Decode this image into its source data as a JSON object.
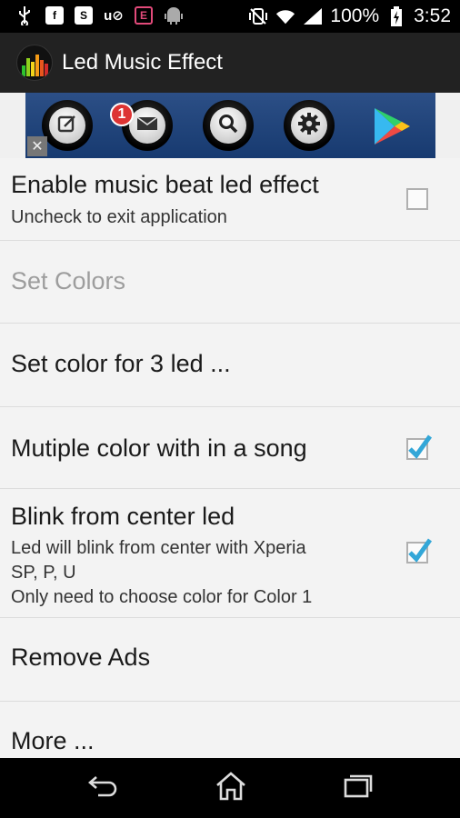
{
  "status_bar": {
    "battery_percent": "100%",
    "time": "3:52",
    "left_icons": [
      "usb-icon",
      "facebook-icon",
      "skype-icon",
      "unknown-app-icon",
      "e-app-icon",
      "android-icon"
    ],
    "right_icons": [
      "vibrate-off-icon",
      "wifi-icon",
      "signal-icon",
      "battery-charging-icon"
    ]
  },
  "app_bar": {
    "title": "Led Music Effect",
    "icon": "equalizer-app-icon"
  },
  "ad": {
    "badge_count": "1",
    "close_label": "✕",
    "buttons": [
      "edit-icon",
      "mail-icon",
      "search-icon",
      "gear-icon",
      "play-store-icon"
    ]
  },
  "settings": {
    "enable": {
      "title": "Enable music beat led effect",
      "summary": "Uncheck to exit application",
      "checked": false
    },
    "set_colors": {
      "title": "Set Colors"
    },
    "set_color_3": {
      "title": "Set color for 3 led ..."
    },
    "multiple": {
      "title": "Mutiple color with in a song",
      "checked": true
    },
    "blink": {
      "title": "Blink from center led",
      "summary_line1": "Led will blink from center with Xperia",
      "summary_line2": "SP, P, U",
      "summary_line3": "Only need to choose color for Color 1",
      "checked": true
    },
    "remove_ads": {
      "title": "Remove Ads"
    },
    "more": {
      "title": "More ..."
    }
  },
  "nav_bar": {
    "buttons": [
      "back-icon",
      "home-icon",
      "recent-apps-icon"
    ]
  },
  "colors": {
    "app_bar": "#222222",
    "list_bg": "#f3f3f3",
    "check_accent": "#33a7d8",
    "ad_bg": "#1f4478",
    "badge": "#dd3333"
  }
}
